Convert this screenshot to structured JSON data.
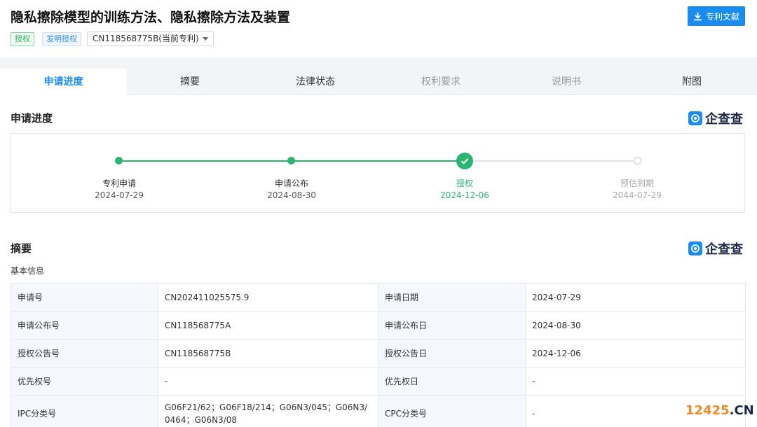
{
  "header": {
    "title": "隐私擦除模型的训练方法、隐私擦除方法及装置",
    "tags": [
      "授权",
      "发明授权"
    ],
    "patent_select": "CN118568775B(当前专利)",
    "doc_button": "专利文献"
  },
  "tabs": [
    {
      "label": "申请进度",
      "state": "active"
    },
    {
      "label": "摘要",
      "state": "normal"
    },
    {
      "label": "法律状态",
      "state": "normal"
    },
    {
      "label": "权利要求",
      "state": "disabled"
    },
    {
      "label": "说明书",
      "state": "disabled"
    },
    {
      "label": "附图",
      "state": "normal"
    }
  ],
  "progress": {
    "section_title": "申请进度",
    "logo_text": "企查查",
    "steps": [
      {
        "label": "专利申请",
        "date": "2024-07-29",
        "status": "done"
      },
      {
        "label": "申请公布",
        "date": "2024-08-30",
        "status": "done"
      },
      {
        "label": "授权",
        "date": "2024-12-06",
        "status": "current"
      },
      {
        "label": "预估到期",
        "date": "2044-07-29",
        "status": "future"
      }
    ]
  },
  "abstract": {
    "section_title": "摘要",
    "logo_text": "企查查",
    "sub_title": "基本信息",
    "rows": [
      {
        "l1": "申请号",
        "v1": "CN202411025575.9",
        "l2": "申请日期",
        "v2": "2024-07-29"
      },
      {
        "l1": "申请公布号",
        "v1": "CN118568775A",
        "l2": "申请公布日",
        "v2": "2024-08-30"
      },
      {
        "l1": "授权公告号",
        "v1": "CN118568775B",
        "l2": "授权公告日",
        "v2": "2024-12-06"
      },
      {
        "l1": "优先权号",
        "v1": "-",
        "l2": "优先权日",
        "v2": "-"
      },
      {
        "l1": "IPC分类号",
        "v1": "G06F21/62；G06F18/214；G06N3/045；G06N3/0464；G06N3/08",
        "l2": "CPC分类号",
        "v2": "-"
      }
    ]
  },
  "watermark": {
    "num": "12425",
    "suffix": ".CN"
  },
  "colors": {
    "accent": "#1a8cf0",
    "success": "#2bb573",
    "brand_dark": "#1d2a44"
  }
}
